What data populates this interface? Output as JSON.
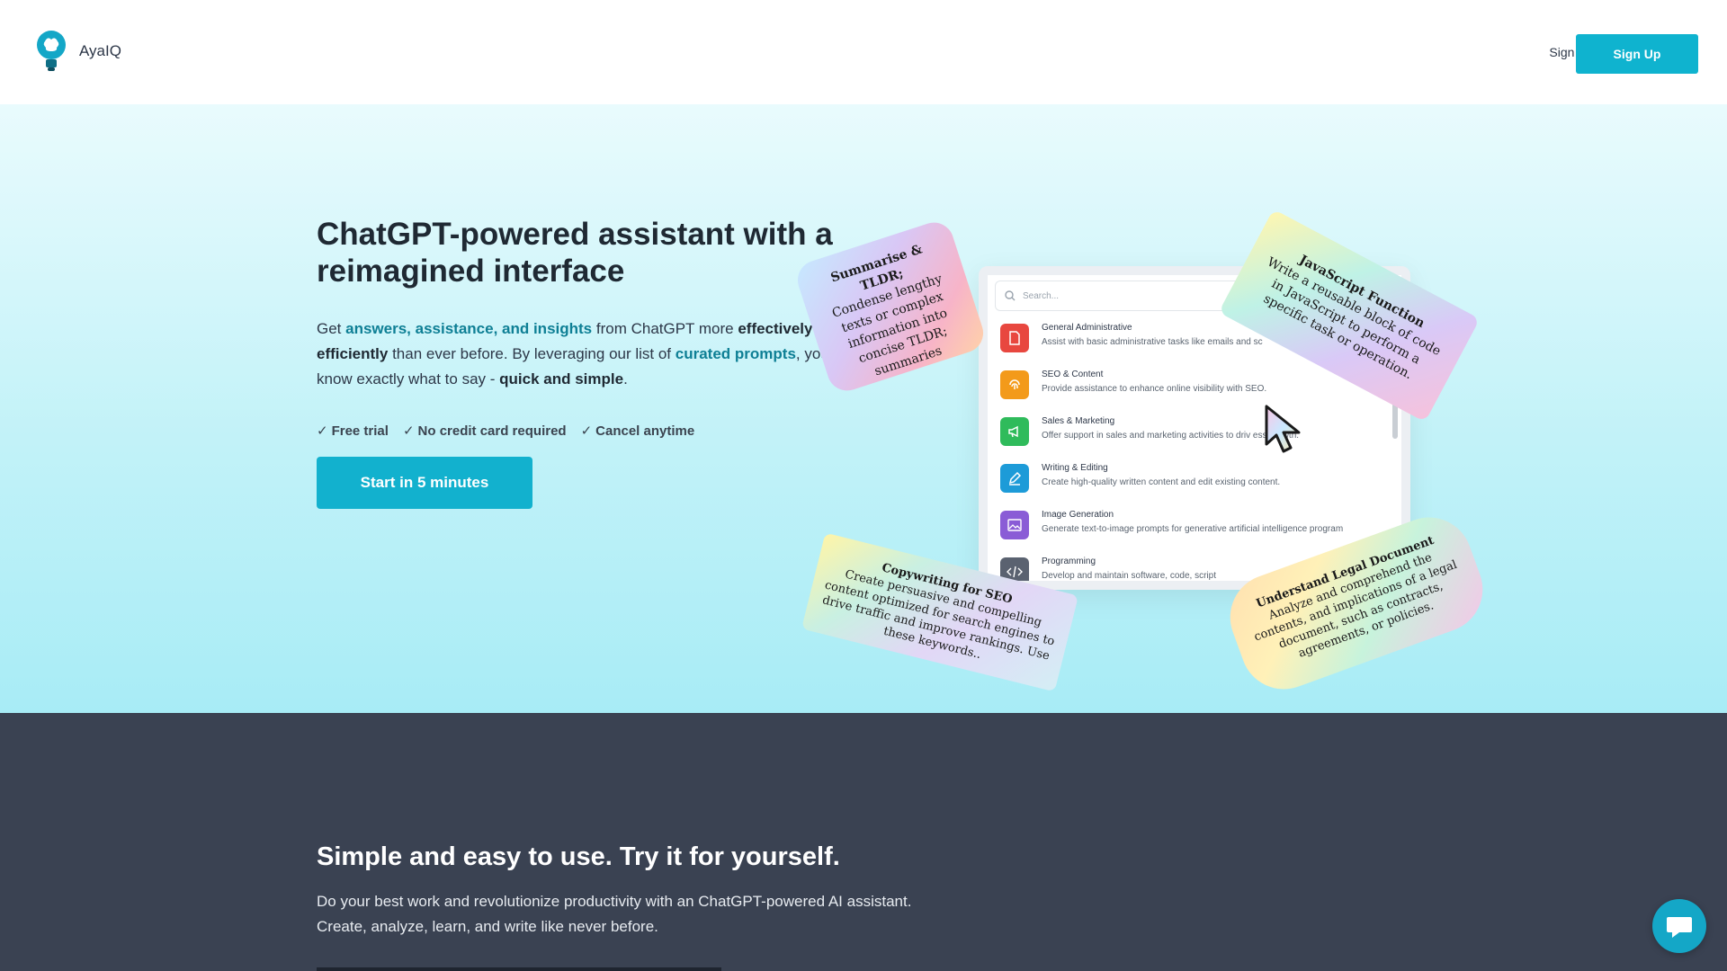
{
  "header": {
    "brand": "AyaIQ",
    "sign_in": "Sign In",
    "sign_up": "Sign Up"
  },
  "hero": {
    "title": "ChatGPT-powered assistant with a reimagined interface",
    "desc": {
      "p1": "Get ",
      "h1": "answers, assistance, and insights",
      "p2": " from ChatGPT more ",
      "b1": "effectively and efficiently",
      "p3": " than ever before. By leveraging our list of ",
      "h2": "curated prompts",
      "p4": ", you’ll know exactly what to say - ",
      "b2": "quick and simple",
      "p5": "."
    },
    "checks": [
      "Free trial",
      "No credit card required",
      "Cancel anytime"
    ],
    "cta": "Start in 5 minutes"
  },
  "panel": {
    "search_placeholder": "Search...",
    "categories": [
      {
        "name": "General Administrative",
        "desc": "Assist with basic administrative tasks like emails and sc",
        "color": "#e8473f",
        "icon": "document-icon"
      },
      {
        "name": "SEO & Content",
        "desc": "Provide assistance to enhance online visibility with SEO.",
        "color": "#f39a1a",
        "icon": "fingerprint-icon"
      },
      {
        "name": "Sales & Marketing",
        "desc": "Offer support in sales and marketing activities to driv      ess growth.",
        "color": "#2fbb5b",
        "icon": "megaphone-icon"
      },
      {
        "name": "Writing & Editing",
        "desc": "Create high-quality written content and edit existing content.",
        "color": "#1d9bd8",
        "icon": "pencil-icon"
      },
      {
        "name": "Image Generation",
        "desc": "Generate text-to-image prompts for generative artificial intelligence program",
        "color": "#8a5cd6",
        "icon": "image-icon"
      },
      {
        "name": "Programming",
        "desc": "Develop and maintain software, code, script",
        "color": "#5a6270",
        "icon": "code-icon"
      }
    ]
  },
  "cards": {
    "summarise": {
      "title": "Summarise & TLDR;",
      "body": "Condense lengthy texts or complex information into concise TLDR; summaries"
    },
    "javascript": {
      "title": "JavaScript Function",
      "body": "Write a reusable block of code in JavaScript to perform a specific task or operation."
    },
    "copywriting": {
      "title": "Copywriting for SEO",
      "body": "Create persuasive and compelling content optimized for search engines to drive traffic and improve rankings. Use these keywords.."
    },
    "legal": {
      "title": "Understand Legal Document",
      "body": "Analyze and comprehend the contents, and implications of a legal document, such as contracts, agreements, or policies."
    }
  },
  "section2": {
    "title": "Simple and easy to use. Try it for yourself.",
    "line1": "Do your best work and revolutionize productivity with an ChatGPT-powered AI assistant.",
    "line2": "Create, analyze, learn, and write like never before."
  },
  "colors": {
    "accent": "#12b1ce",
    "dark_bg": "#3a4252",
    "highlight": "#0e7f95"
  },
  "chat": {
    "icon": "chat-bubble-icon"
  }
}
